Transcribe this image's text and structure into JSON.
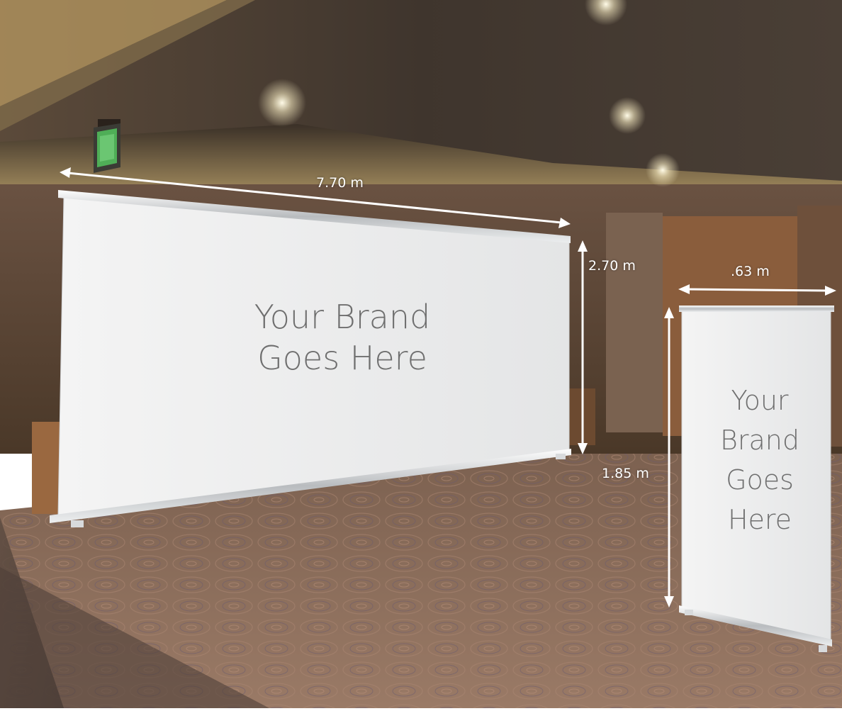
{
  "dimensions": {
    "large_width": "7.70 m",
    "large_height": "2.70 m",
    "small_width": ".63 m",
    "small_height": "1.85 m"
  },
  "large_banner": {
    "text_lines": [
      "Your Brand",
      "Goes Here"
    ]
  },
  "small_banner": {
    "text_lines": [
      "Your",
      "Brand",
      "Goes",
      "Here"
    ]
  },
  "exit_sign": {
    "icon": "exit-sign-icon"
  },
  "colors": {
    "ceiling": "#4a3f36",
    "ceiling_light": "#cdb681",
    "wall": "#5a4536",
    "carpet": "#8a6c5a",
    "banner": "#eceded",
    "banner_text": "#6f6f6f",
    "arrow": "#ffffff"
  }
}
